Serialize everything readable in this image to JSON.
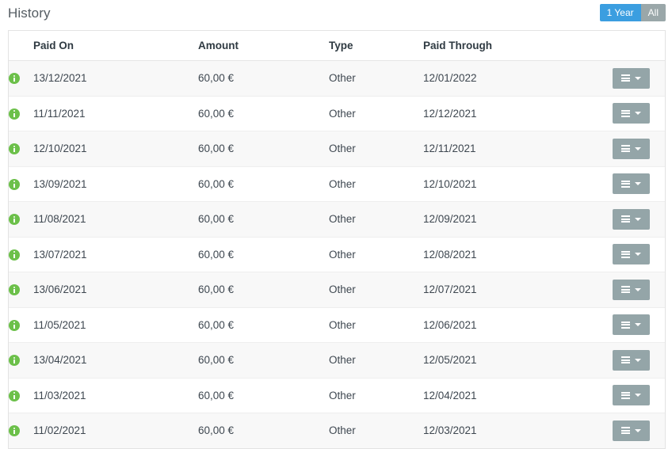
{
  "header": {
    "title": "History",
    "range_buttons": [
      {
        "label": "1 Year",
        "active": true
      },
      {
        "label": "All",
        "active": false
      }
    ]
  },
  "table": {
    "columns": [
      "",
      "Paid On",
      "Amount",
      "Type",
      "Paid Through",
      ""
    ],
    "rows": [
      {
        "status": "info",
        "paid_on": "13/12/2021",
        "amount": "60,00 €",
        "type": "Other",
        "paid_through": "12/01/2022"
      },
      {
        "status": "info",
        "paid_on": "11/11/2021",
        "amount": "60,00 €",
        "type": "Other",
        "paid_through": "12/12/2021"
      },
      {
        "status": "info",
        "paid_on": "12/10/2021",
        "amount": "60,00 €",
        "type": "Other",
        "paid_through": "12/11/2021"
      },
      {
        "status": "info",
        "paid_on": "13/09/2021",
        "amount": "60,00 €",
        "type": "Other",
        "paid_through": "12/10/2021"
      },
      {
        "status": "info",
        "paid_on": "11/08/2021",
        "amount": "60,00 €",
        "type": "Other",
        "paid_through": "12/09/2021"
      },
      {
        "status": "info",
        "paid_on": "13/07/2021",
        "amount": "60,00 €",
        "type": "Other",
        "paid_through": "12/08/2021"
      },
      {
        "status": "info",
        "paid_on": "13/06/2021",
        "amount": "60,00 €",
        "type": "Other",
        "paid_through": "12/07/2021"
      },
      {
        "status": "info",
        "paid_on": "11/05/2021",
        "amount": "60,00 €",
        "type": "Other",
        "paid_through": "12/06/2021"
      },
      {
        "status": "info",
        "paid_on": "13/04/2021",
        "amount": "60,00 €",
        "type": "Other",
        "paid_through": "12/05/2021"
      },
      {
        "status": "info",
        "paid_on": "11/03/2021",
        "amount": "60,00 €",
        "type": "Other",
        "paid_through": "12/04/2021"
      },
      {
        "status": "info",
        "paid_on": "11/02/2021",
        "amount": "60,00 €",
        "type": "Other",
        "paid_through": "12/03/2021"
      }
    ],
    "row_action": {
      "icon": "hamburger-menu-icon",
      "caret": "chevron-down-icon"
    },
    "status_icon": "info-circle-icon"
  },
  "colors": {
    "accent_blue": "#3b9ee0",
    "idle_gray": "#9aa7a9",
    "action_gray": "#94a5a8",
    "status_green": "#6cc04a",
    "title_text": "#555d63",
    "header_text": "#2f3a42",
    "body_text": "#3e4750",
    "row_stripe": "#f8f8f8",
    "border": "#e3e3e3"
  }
}
